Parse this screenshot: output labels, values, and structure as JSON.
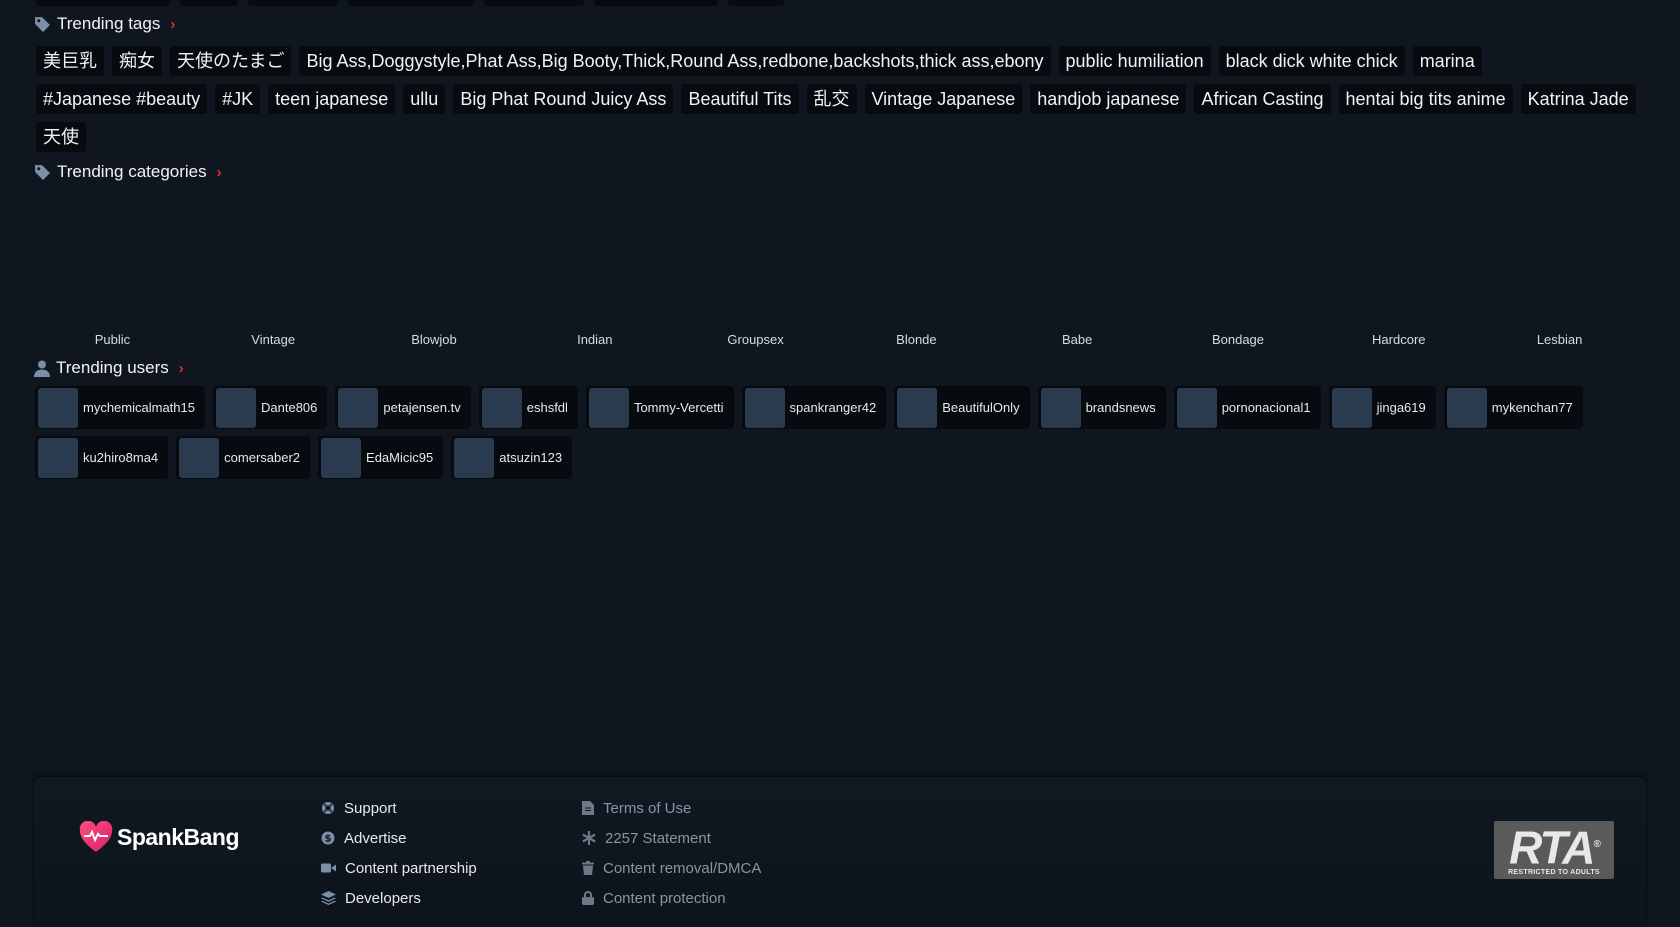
{
  "colors": {
    "background": "#0f161f",
    "chip": "#070b10",
    "accent_chevron": "#e0312b",
    "icon": "#7b8fa8",
    "avatar": "#2a3a4f"
  },
  "trending_tags": {
    "title": "Trending tags",
    "tags": [
      "美巨乳",
      "痴女",
      "天使のたまご",
      "Big Ass,Doggystyle,Phat Ass,Big Booty,Thick,Round Ass,redbone,backshots,thick ass,ebony",
      "public humiliation",
      "black dick white chick",
      "marina",
      "#Japanese #beauty",
      "#JK",
      "teen japanese",
      "ullu",
      "Big Phat Round Juicy Ass",
      "Beautiful Tits",
      "乱交",
      "Vintage Japanese",
      "handjob japanese",
      "African Casting",
      "hentai big tits anime",
      "Katrina Jade",
      "天使"
    ]
  },
  "trending_categories": {
    "title": "Trending categories",
    "categories": [
      "Public",
      "Vintage",
      "Blowjob",
      "Indian",
      "Groupsex",
      "Blonde",
      "Babe",
      "Bondage",
      "Hardcore",
      "Lesbian"
    ]
  },
  "trending_users": {
    "title": "Trending users",
    "users": [
      "mychemicalmath15",
      "Dante806",
      "petajensen.tv",
      "eshsfdl",
      "Tommy-Vercetti",
      "spankranger42",
      "BeautifulOnly",
      "brandsnews",
      "pornonacional1",
      "jinga619",
      "mykenchan77",
      "ku2hiro8ma4",
      "comersaber2",
      "EdaMicic95",
      "atsuzin123"
    ]
  },
  "footer": {
    "logo_text": "SpankBang",
    "col1": [
      {
        "label": "Support",
        "icon": "lifebuoy-icon"
      },
      {
        "label": "Advertise",
        "icon": "dollar-icon"
      },
      {
        "label": "Content partnership",
        "icon": "video-camera-icon"
      },
      {
        "label": "Developers",
        "icon": "layers-icon"
      }
    ],
    "col2": [
      {
        "label": "Terms of Use",
        "icon": "document-icon"
      },
      {
        "label": "2257 Statement",
        "icon": "asterisk-icon"
      },
      {
        "label": "Content removal/DMCA",
        "icon": "trash-icon"
      },
      {
        "label": "Content protection",
        "icon": "lock-icon"
      }
    ],
    "rta": {
      "big": "RTA",
      "small": "RESTRICTED TO ADULTS",
      "mark": "®"
    }
  }
}
